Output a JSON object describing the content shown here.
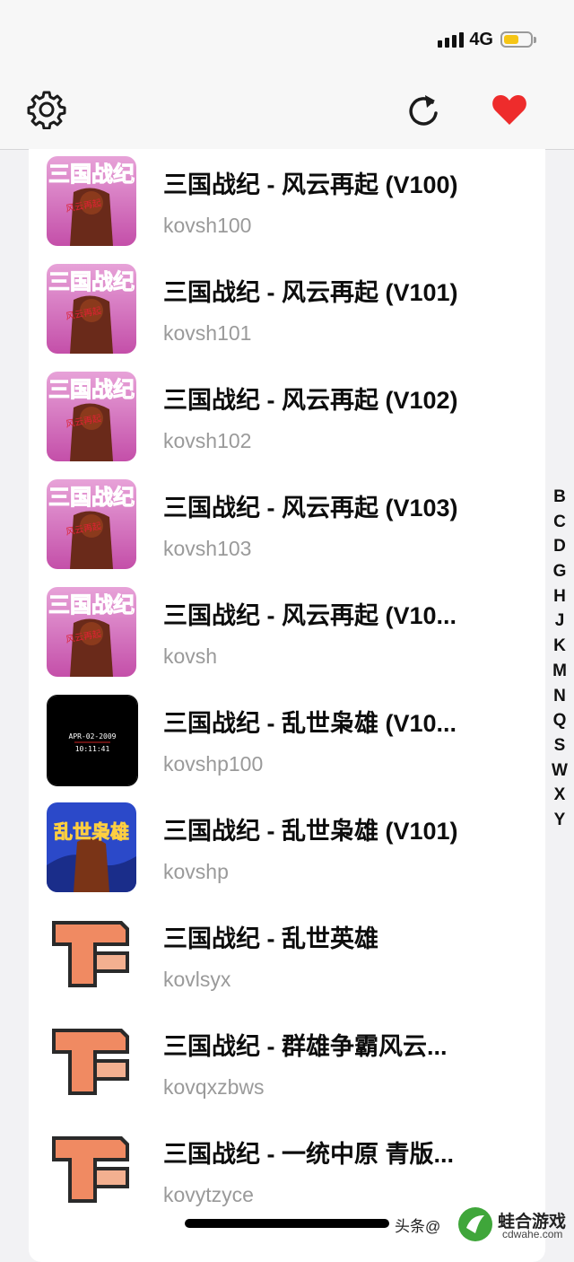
{
  "status_bar": {
    "network": "4G"
  },
  "toolbar": {
    "settings_icon": "gear-icon",
    "refresh_icon": "refresh-icon",
    "favorite_icon": "heart-icon"
  },
  "games": [
    {
      "title": "三国战纪 - 风云再起 (V100)",
      "rom": "kovsh100",
      "thumb": "fyzq"
    },
    {
      "title": "三国战纪 - 风云再起 (V101)",
      "rom": "kovsh101",
      "thumb": "fyzq"
    },
    {
      "title": "三国战纪 - 风云再起 (V102)",
      "rom": "kovsh102",
      "thumb": "fyzq"
    },
    {
      "title": "三国战纪 - 风云再起 (V103)",
      "rom": "kovsh103",
      "thumb": "fyzq"
    },
    {
      "title": "三国战纪 - 风云再起 (V10...",
      "rom": "kovsh",
      "thumb": "fyzq"
    },
    {
      "title": "三国战纪 - 乱世枭雄 (V10...",
      "rom": "kovshp100",
      "thumb": "black"
    },
    {
      "title": "三国战纪 - 乱世枭雄 (V101)",
      "rom": "kovshp",
      "thumb": "lsxx"
    },
    {
      "title": "三国战纪 - 乱世英雄",
      "rom": "kovlsyx",
      "thumb": "pixel"
    },
    {
      "title": "三国战纪 - 群雄争霸风云...",
      "rom": "kovqxzbws",
      "thumb": "pixel"
    },
    {
      "title": "三国战纪 - 一统中原 青版...",
      "rom": "kovytzyce",
      "thumb": "pixel"
    }
  ],
  "thumb_text": {
    "fyzq_logo": "三国战纪",
    "fyzq_sub": "风云再起",
    "black_date": "APR-02-2009",
    "black_time": "10:11:41",
    "lsxx_logo": "乱世枭雄"
  },
  "index_letters": [
    "B",
    "C",
    "D",
    "G",
    "H",
    "J",
    "K",
    "M",
    "N",
    "Q",
    "S",
    "W",
    "X",
    "Y"
  ],
  "watermark": {
    "left": "头条@",
    "brand": "蛙合游戏",
    "url": "cdwahe.com"
  }
}
